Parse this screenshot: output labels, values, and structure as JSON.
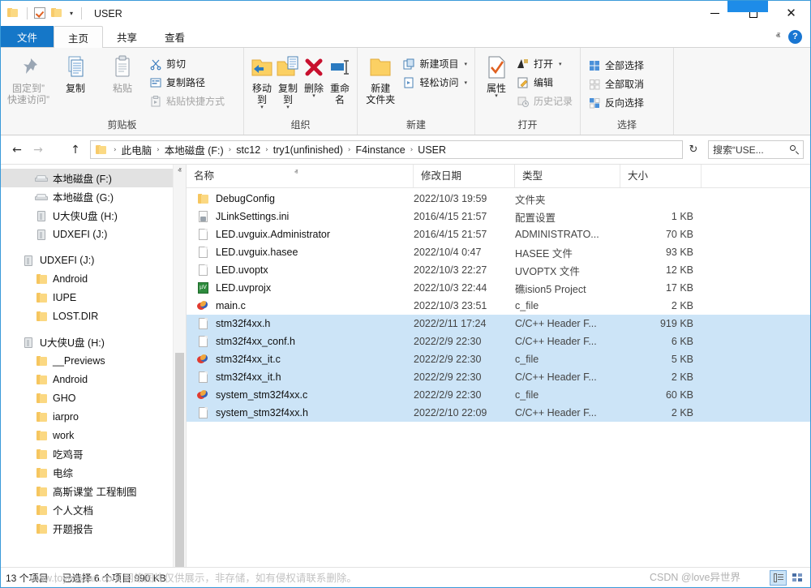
{
  "window": {
    "title": "USER",
    "minimize_label": "—",
    "maximize_label": "",
    "close_label": "✕"
  },
  "quick_access_toolbar": {
    "items": [
      {
        "name": "properties-icon",
        "label": ""
      },
      {
        "name": "new-folder-icon",
        "label": ""
      },
      {
        "name": "customize-caret",
        "label": "▾"
      }
    ]
  },
  "ribbon": {
    "tabs": [
      {
        "id": "file",
        "label": "文件"
      },
      {
        "id": "home",
        "label": "主页"
      },
      {
        "id": "share",
        "label": "共享"
      },
      {
        "id": "view",
        "label": "查看"
      }
    ],
    "collapse_caret": "ⱏ",
    "help_label": "?",
    "groups": [
      {
        "id": "clipboard",
        "label": "剪贴板",
        "big_buttons": [
          {
            "name": "pin-to-quick-access",
            "label_line1": "固定到”",
            "label_line2": "快速访问”",
            "disabled": true
          },
          {
            "name": "copy-button",
            "label_line1": "复制",
            "label_line2": "",
            "disabled": false
          },
          {
            "name": "paste-button",
            "label_line1": "粘贴",
            "label_line2": "",
            "disabled": true
          }
        ],
        "small_buttons": [
          {
            "name": "cut-button",
            "label": "剪切",
            "disabled": false
          },
          {
            "name": "copy-path-button",
            "label": "复制路径",
            "disabled": false
          },
          {
            "name": "paste-shortcut-button",
            "label": "粘贴快捷方式",
            "disabled": true
          }
        ]
      },
      {
        "id": "organize",
        "label": "组织",
        "big_buttons": [
          {
            "name": "move-to-button",
            "label_line1": "移动到",
            "has_caret": true
          },
          {
            "name": "copy-to-button",
            "label_line1": "复制到",
            "has_caret": true
          },
          {
            "name": "delete-button",
            "label_line1": "删除",
            "has_caret": true
          },
          {
            "name": "rename-button",
            "label_line1": "重命名",
            "has_caret": false
          }
        ]
      },
      {
        "id": "new",
        "label": "新建",
        "big_buttons": [
          {
            "name": "new-folder-button",
            "label_line1": "新建",
            "label_line2": "文件夹"
          }
        ],
        "small_buttons": [
          {
            "name": "new-item-button",
            "label": "新建项目",
            "caret": "▾"
          },
          {
            "name": "easy-access-button",
            "label": "轻松访问",
            "caret": "▾"
          }
        ]
      },
      {
        "id": "open",
        "label": "打开",
        "big_buttons": [
          {
            "name": "properties-button",
            "label_line1": "属性",
            "has_caret": true
          }
        ],
        "small_buttons": [
          {
            "name": "open-button",
            "label": "打开",
            "caret": "▾",
            "disabled": false
          },
          {
            "name": "edit-button",
            "label": "编辑",
            "disabled": false
          },
          {
            "name": "history-button",
            "label": "历史记录",
            "disabled": true
          }
        ]
      },
      {
        "id": "select",
        "label": "选择",
        "small_buttons": [
          {
            "name": "select-all-button",
            "label": "全部选择"
          },
          {
            "name": "select-none-button",
            "label": "全部取消"
          },
          {
            "name": "invert-selection-button",
            "label": "反向选择"
          }
        ]
      }
    ]
  },
  "address_bar": {
    "back_label": "←",
    "forward_label": "→",
    "recent_label": "ⱟ",
    "up_label": "↑",
    "breadcrumbs": [
      "此电脑",
      "本地磁盘 (F:)",
      "stc12",
      "try1(unfinished)",
      "F4instance",
      "USER"
    ],
    "separator": "›",
    "dropdown_caret": "ⱟ",
    "refresh_label": "↻",
    "search_placeholder": "搜索“USE..."
  },
  "sidebar": {
    "items": [
      {
        "label": "本地磁盘 (F:)",
        "icon": "drive-icon",
        "indent": 2,
        "selected": true
      },
      {
        "label": "本地磁盘 (G:)",
        "icon": "drive-icon",
        "indent": 2,
        "selected": false
      },
      {
        "label": "U大侠U盘 (H:)",
        "icon": "usb-icon",
        "indent": 2,
        "selected": false
      },
      {
        "label": "UDXEFI (J:)",
        "icon": "usb-icon",
        "indent": 2,
        "selected": false
      },
      {
        "label": "",
        "icon": "spacer",
        "indent": 0,
        "selected": false
      },
      {
        "label": "UDXEFI (J:)",
        "icon": "usb-icon",
        "indent": 1,
        "selected": false
      },
      {
        "label": "Android",
        "icon": "folder-icon",
        "indent": 2,
        "selected": false
      },
      {
        "label": "IUPE",
        "icon": "folder-icon",
        "indent": 2,
        "selected": false
      },
      {
        "label": "LOST.DIR",
        "icon": "folder-icon",
        "indent": 2,
        "selected": false
      },
      {
        "label": "",
        "icon": "spacer",
        "indent": 0,
        "selected": false
      },
      {
        "label": "U大侠U盘 (H:)",
        "icon": "usb-icon",
        "indent": 1,
        "selected": false
      },
      {
        "label": "__Previews",
        "icon": "folder-icon",
        "indent": 2,
        "selected": false
      },
      {
        "label": "Android",
        "icon": "folder-icon",
        "indent": 2,
        "selected": false
      },
      {
        "label": "GHO",
        "icon": "folder-icon",
        "indent": 2,
        "selected": false
      },
      {
        "label": "iarpro",
        "icon": "folder-icon",
        "indent": 2,
        "selected": false
      },
      {
        "label": "work",
        "icon": "folder-icon",
        "indent": 2,
        "selected": false
      },
      {
        "label": "吃鸡哥",
        "icon": "folder-icon",
        "indent": 2,
        "selected": false
      },
      {
        "label": "电综",
        "icon": "folder-icon",
        "indent": 2,
        "selected": false
      },
      {
        "label": "高斯课堂 工程制图",
        "icon": "folder-icon",
        "indent": 2,
        "selected": false
      },
      {
        "label": "个人文档",
        "icon": "folder-icon",
        "indent": 2,
        "selected": false
      },
      {
        "label": "开题报告",
        "icon": "folder-icon",
        "indent": 2,
        "selected": false
      }
    ],
    "scroll_up": "ⱏ",
    "scroll_down": "ⱟ"
  },
  "file_list": {
    "columns": [
      {
        "id": "name",
        "label": "名称"
      },
      {
        "id": "date",
        "label": "修改日期"
      },
      {
        "id": "type",
        "label": "类型"
      },
      {
        "id": "size",
        "label": "大小"
      }
    ],
    "sort_indicator": "ⱏ",
    "rows": [
      {
        "name": "DebugConfig",
        "date": "2022/10/3 19:59",
        "type": "文件夹",
        "size": "",
        "icon": "folder-icon",
        "selected": false
      },
      {
        "name": "JLinkSettings.ini",
        "date": "2016/4/15 21:57",
        "type": "配置设置",
        "size": "1 KB",
        "icon": "ini-file-icon",
        "selected": false
      },
      {
        "name": "LED.uvguix.Administrator",
        "date": "2016/4/15 21:57",
        "type": "ADMINISTRATO...",
        "size": "70 KB",
        "icon": "generic-file-icon",
        "selected": false
      },
      {
        "name": "LED.uvguix.hasee",
        "date": "2022/10/4 0:47",
        "type": "HASEE 文件",
        "size": "93 KB",
        "icon": "generic-file-icon",
        "selected": false
      },
      {
        "name": "LED.uvoptx",
        "date": "2022/10/3 22:27",
        "type": "UVOPTX 文件",
        "size": "12 KB",
        "icon": "generic-file-icon",
        "selected": false
      },
      {
        "name": "LED.uvprojx",
        "date": "2022/10/3 22:44",
        "type": "礁ision5 Project",
        "size": "17 KB",
        "icon": "uvision-file-icon",
        "selected": false
      },
      {
        "name": "main.c",
        "date": "2022/10/3 23:51",
        "type": "c_file",
        "size": "2 KB",
        "icon": "c-file-icon",
        "selected": false
      },
      {
        "name": "stm32f4xx.h",
        "date": "2022/2/11 17:24",
        "type": "C/C++ Header F...",
        "size": "919 KB",
        "icon": "generic-file-icon",
        "selected": true
      },
      {
        "name": "stm32f4xx_conf.h",
        "date": "2022/2/9 22:30",
        "type": "C/C++ Header F...",
        "size": "6 KB",
        "icon": "generic-file-icon",
        "selected": true
      },
      {
        "name": "stm32f4xx_it.c",
        "date": "2022/2/9 22:30",
        "type": "c_file",
        "size": "5 KB",
        "icon": "c-file-icon",
        "selected": true
      },
      {
        "name": "stm32f4xx_it.h",
        "date": "2022/2/9 22:30",
        "type": "C/C++ Header F...",
        "size": "2 KB",
        "icon": "generic-file-icon",
        "selected": true
      },
      {
        "name": "system_stm32f4xx.c",
        "date": "2022/2/9 22:30",
        "type": "c_file",
        "size": "60 KB",
        "icon": "c-file-icon",
        "selected": true
      },
      {
        "name": "system_stm32f4xx.h",
        "date": "2022/2/10 22:09",
        "type": "C/C++ Header F...",
        "size": "2 KB",
        "icon": "generic-file-icon",
        "selected": true
      }
    ]
  },
  "status_bar": {
    "item_count": "13 个项目",
    "selection_info": "已选择 6 个项目  990 KB",
    "view_details": "",
    "view_tiles": ""
  },
  "watermarks": {
    "left": "www.toymoban.com 网络图片仅供展示，非存储，如有侵权请联系删除。",
    "right": "CSDN @love异世界"
  },
  "colors": {
    "accent": "#1577c8",
    "selection": "#cce4f7",
    "title_highlight": "#1e8ce8",
    "folder": "#fbd882"
  }
}
